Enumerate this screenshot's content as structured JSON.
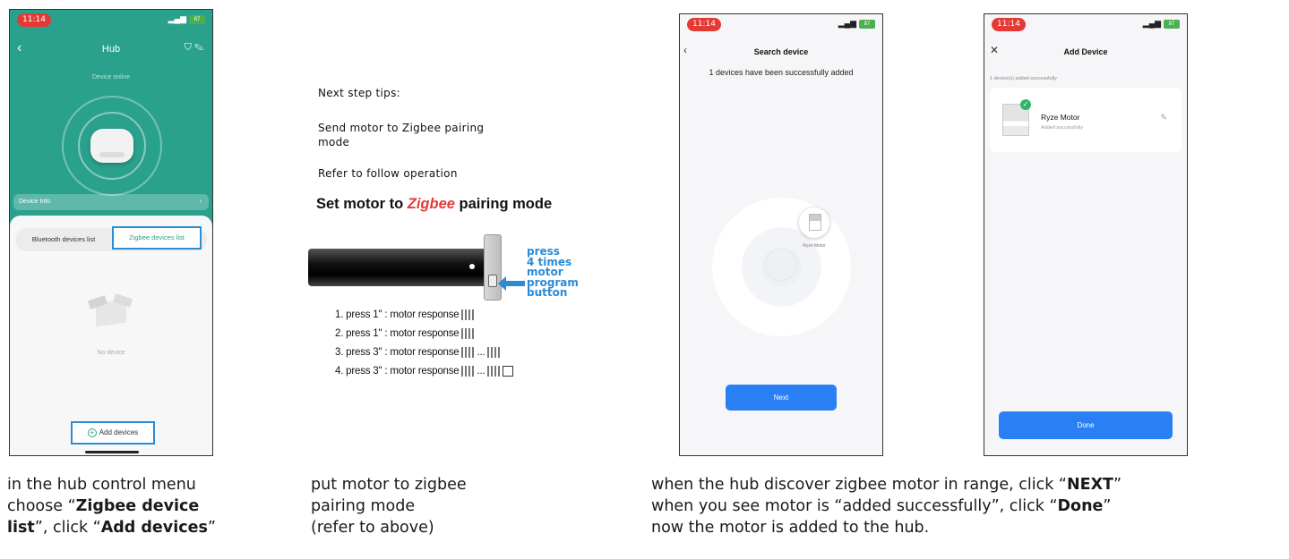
{
  "screen1": {
    "time": "11:14",
    "battery": "87",
    "title": "Hub",
    "status": "Device online",
    "device_info_label": "Device Info",
    "tab_bluetooth": "Bluetooth devices list",
    "tab_zigbee": "Zigbee devices list",
    "empty_text": "No device",
    "add_button": "Add devices"
  },
  "tips": {
    "heading": "Next step tips:",
    "line1a": "Send motor to Zigbee pairing",
    "line1b": "mode",
    "line2": "Refer to follow operation",
    "set_title_pre": "Set motor to ",
    "set_title_em": "Zigbee",
    "set_title_post": " pairing mode",
    "press_note": [
      "press",
      "4 times",
      "motor",
      "program",
      "button"
    ],
    "steps": [
      "1. press 1\"   : motor response",
      "2. press 1\"   : motor response",
      "3. press 3\"   : motor response",
      "4. press 3\"   : motor response"
    ],
    "ellipsis": "..."
  },
  "screen3": {
    "time": "11:14",
    "battery": "87",
    "title": "Search device",
    "message": "1 devices have been successfully added",
    "found_label": "Ryze Motor",
    "next_button": "Next"
  },
  "screen4": {
    "time": "11:14",
    "battery": "87",
    "title": "Add Device",
    "message": "1 device(s) added successfully",
    "device_name": "Ryze Motor",
    "device_status": "Added successfully",
    "done_button": "Done"
  },
  "captions": {
    "c1": {
      "l1": "in the hub control menu",
      "l2_pre": "choose “",
      "l2_bold": "Zigbee device",
      "l3_bold": "list",
      "l3_mid": "”, click “",
      "l3_bold2": "Add devices",
      "l3_post": "”"
    },
    "c2": {
      "l1": "put motor to zigbee",
      "l2": "pairing mode",
      "l3": "(refer to above)"
    },
    "c3": {
      "l1_pre": "when the hub discover zigbee motor in range, click “",
      "l1_bold": "NEXT",
      "l1_post": "”",
      "l2_pre": "when you see motor is “added successfully”, click “",
      "l2_bold": "Done",
      "l2_post": "”",
      "l3": "now the motor is added to the hub."
    }
  }
}
